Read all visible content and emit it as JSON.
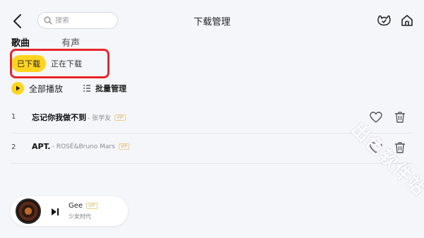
{
  "header": {
    "title": "下载管理",
    "search_placeholder": "搜索"
  },
  "tabs": [
    {
      "label": "歌曲",
      "active": true
    },
    {
      "label": "有声",
      "active": false
    }
  ],
  "subtabs": [
    {
      "label": "已下载",
      "active": true
    },
    {
      "label": "正在下载",
      "active": false
    }
  ],
  "actions": {
    "play_all": "全部播放",
    "batch_manage": "批量管理"
  },
  "songs": [
    {
      "index": "1",
      "title": "忘记你我做不到",
      "artist": "- 张学友",
      "badge": "VIP"
    },
    {
      "index": "2",
      "title": "APT.",
      "artist": "- ROSÉ&Bruno Mars",
      "badge": "VIP"
    }
  ],
  "player": {
    "title": "Gee",
    "badge": "VIP",
    "artist": "少女时代"
  },
  "watermark": "出色软件站",
  "colors": {
    "accent": "#ffd51f",
    "highlight_border": "#e8262a",
    "background": "#f5f6fa"
  }
}
